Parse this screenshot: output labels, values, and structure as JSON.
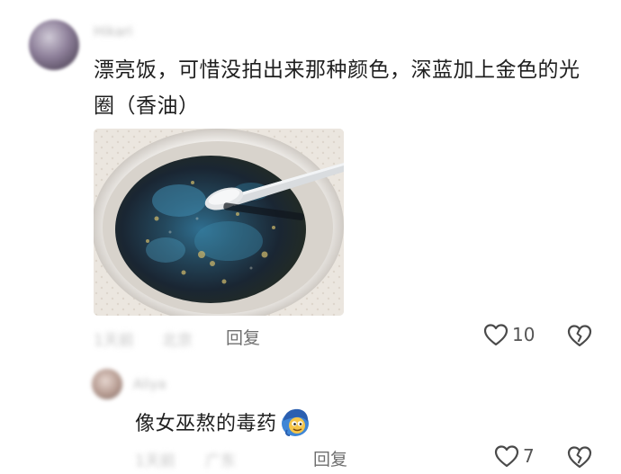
{
  "main_comment": {
    "username": "Hikari",
    "text": "漂亮饭，可惜没拍出来那种颜色，深蓝加上金色的光圈（香油）",
    "photo_icon": "soup-bowl-photo",
    "time": "1天前",
    "location": "北京",
    "reply_label": "回复",
    "like_count": "10",
    "like_icon": "heart-outline-icon",
    "dislike_icon": "broken-heart-icon"
  },
  "reply_comment": {
    "username": "Aliya",
    "text": "像女巫熬的毒药",
    "emoji_icon": "witch-emoji-icon",
    "time": "1天前",
    "location": "广东",
    "reply_label": "回复",
    "like_count": "7",
    "like_icon": "heart-outline-icon",
    "dislike_icon": "broken-heart-icon"
  },
  "colors": {
    "text_primary": "#1f1f1f",
    "text_secondary": "#6f6f6f",
    "text_blurred": "#c4c4c4",
    "soup_dark": "#1c2a36",
    "soup_blue": "#2f6e8f"
  }
}
